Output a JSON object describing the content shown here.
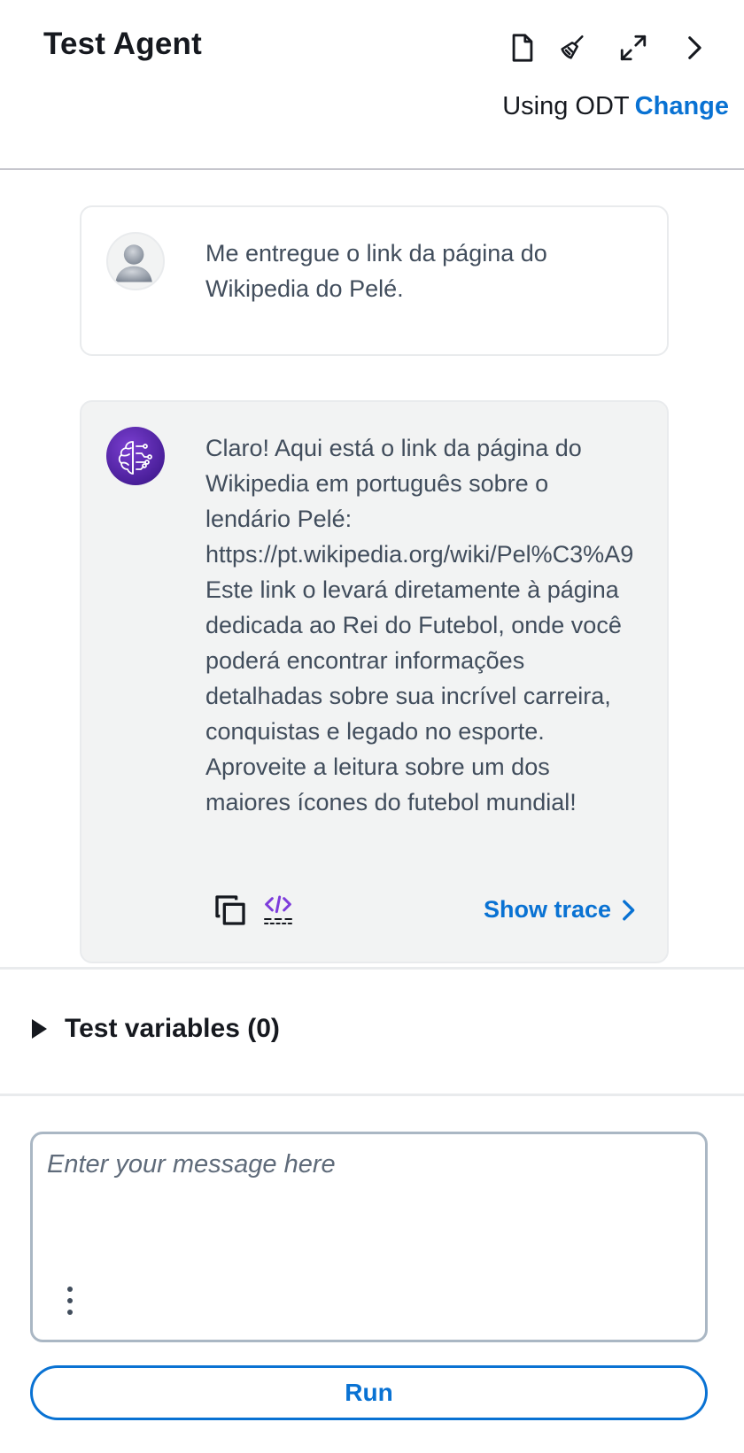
{
  "header": {
    "title": "Test Agent",
    "icons": [
      "document-icon",
      "broom-icon",
      "expand-icon",
      "chevron-right-icon"
    ],
    "odt_text": "Using ODT",
    "change_label": "Change"
  },
  "messages": [
    {
      "role": "user",
      "avatar": "user-avatar",
      "text": "Me entregue o link da página do Wikipedia do Pelé."
    },
    {
      "role": "agent",
      "avatar": "agent-brain-avatar",
      "text": "Claro! Aqui está o link da página do Wikipedia em português sobre o lendário Pelé: https://pt.wikipedia.org/wiki/Pel%C3%A9 Este link o levará diretamente à página dedicada ao Rei do Futebol, onde você poderá encontrar informações detalhadas sobre sua incrível carreira, conquistas e legado no esporte. Aproveite a leitura sobre um dos maiores ícones do futebol mundial!",
      "show_trace_label": "Show trace"
    }
  ],
  "test_variables": {
    "label": "Test variables (0)"
  },
  "input": {
    "placeholder": "Enter your message here",
    "value": ""
  },
  "run_label": "Run",
  "colors": {
    "accent": "#0972d3",
    "agent_bubble": "#f2f3f3",
    "border": "#e9ebed",
    "text": "#16191f"
  }
}
